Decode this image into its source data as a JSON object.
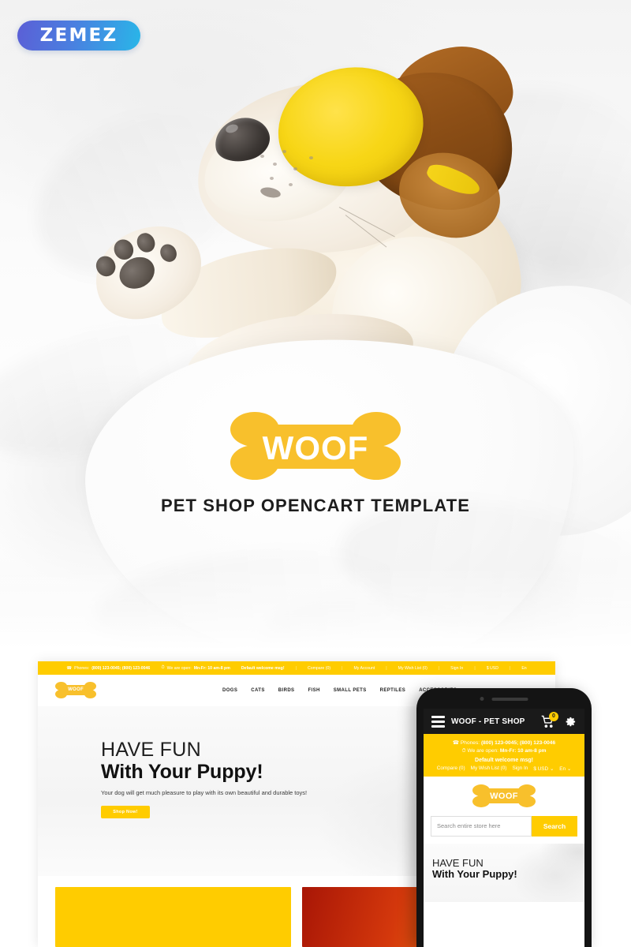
{
  "brand": {
    "badge": "ZEMEZ"
  },
  "hero": {
    "logo_text": "WOOF",
    "tagline": "PET SHOP OPENCART TEMPLATE",
    "photo_alt": "sleeping-dog-photo"
  },
  "colors": {
    "bone_yellow": "#F8C02C",
    "bar_yellow": "#FFCC00",
    "dark": "#1A1A1A",
    "zemez_from": "#5B5FD6",
    "zemez_to": "#29B6E8",
    "promo_orange": "#D4380C"
  },
  "desktop": {
    "topbar": {
      "phones_label": "Phones:",
      "phones_value": "(800) 123-0045; (800) 123-0046",
      "open_label": "We are open:",
      "open_value": "Mn-Fr: 10 am-8 pm",
      "welcome": "Default welcome msg!",
      "links": [
        "Compare (0)",
        "My Account",
        "My Wish List (0)",
        "Sign In",
        "$ USD",
        "En"
      ],
      "phone_icon": "phone-icon",
      "clock_icon": "clock-icon"
    },
    "logo_text": "WOOF",
    "nav": [
      "DOGS",
      "CATS",
      "BIRDS",
      "FISH",
      "SMALL PETS",
      "REPTILES",
      "ACCESSORIES"
    ],
    "hero": {
      "line1": "HAVE FUN",
      "line2": "With Your Puppy!",
      "subtitle": "Your dog will get much pleasure to play with its own beautiful and durable toys!",
      "cta": "Shop Now!"
    },
    "promos": [
      {
        "name": "promo-yellow",
        "color": "#FFCC00"
      },
      {
        "name": "promo-orange",
        "color": "#D4380C"
      }
    ]
  },
  "mobile": {
    "header": {
      "menu_icon": "hamburger-icon",
      "title": "WOOF - PET SHOP",
      "cart_icon": "cart-icon",
      "cart_count": "0",
      "settings_icon": "gear-icon"
    },
    "topbar": {
      "phones_label": "Phones:",
      "phones_value": "(800) 123-0045; (800) 123-0046",
      "open_label": "We are open:",
      "open_value": "Mn-Fr: 10 am-8 pm",
      "welcome": "Default welcome msg!",
      "links": [
        "Compare (0)",
        "My Wish List (0)",
        "Sign In",
        "$ USD ⌄",
        "En ⌄"
      ]
    },
    "logo_text": "WOOF",
    "search": {
      "placeholder": "Search entire store here",
      "button": "Search"
    },
    "hero": {
      "line1": "HAVE FUN",
      "line2": "With Your Puppy!"
    }
  }
}
